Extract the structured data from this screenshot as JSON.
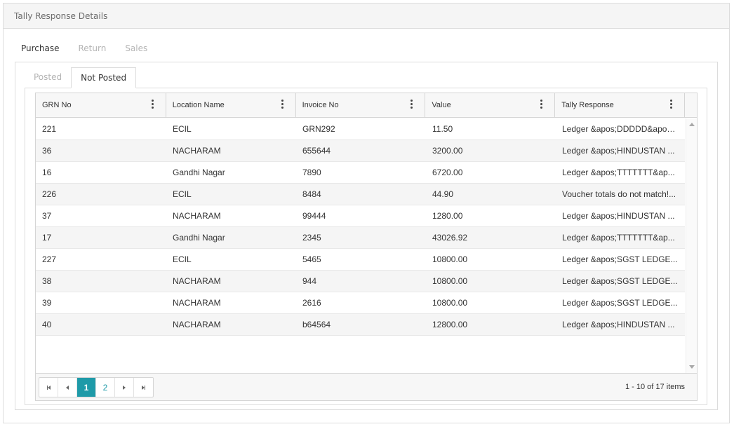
{
  "panel": {
    "title": "Tally Response Details"
  },
  "main_tabs": [
    {
      "label": "Purchase",
      "active": true
    },
    {
      "label": "Return",
      "active": false
    },
    {
      "label": "Sales",
      "active": false
    }
  ],
  "sub_tabs": [
    {
      "label": "Posted",
      "active": false
    },
    {
      "label": "Not Posted",
      "active": true
    }
  ],
  "grid": {
    "columns": [
      "GRN No",
      "Location Name",
      "Invoice No",
      "Value",
      "Tally Response"
    ],
    "rows": [
      [
        "221",
        "ECIL",
        "GRN292",
        "11.50",
        "Ledger &apos;DDDDD&apos;..."
      ],
      [
        "36",
        "NACHARAM",
        "655644",
        "3200.00",
        "Ledger &apos;HINDUSTAN ..."
      ],
      [
        "16",
        "Gandhi Nagar",
        "7890",
        "6720.00",
        "Ledger &apos;TTTTTTT&ap..."
      ],
      [
        "226",
        "ECIL",
        "8484",
        "44.90",
        "Voucher totals do not match!..."
      ],
      [
        "37",
        "NACHARAM",
        "99444",
        "1280.00",
        "Ledger &apos;HINDUSTAN ..."
      ],
      [
        "17",
        "Gandhi Nagar",
        "2345",
        "43026.92",
        "Ledger &apos;TTTTTTT&ap..."
      ],
      [
        "227",
        "ECIL",
        "5465",
        "10800.00",
        "Ledger &apos;SGST LEDGE..."
      ],
      [
        "38",
        "NACHARAM",
        "944",
        "10800.00",
        "Ledger &apos;SGST LEDGE..."
      ],
      [
        "39",
        "NACHARAM",
        "2616",
        "10800.00",
        "Ledger &apos;SGST LEDGE..."
      ],
      [
        "40",
        "NACHARAM",
        "b64564",
        "12800.00",
        "Ledger &apos;HINDUSTAN ..."
      ]
    ]
  },
  "pager": {
    "pages": [
      "1",
      "2"
    ],
    "current_page": "1",
    "info": "1 - 10 of 17 items"
  },
  "colors": {
    "accent": "#1e9aa8"
  }
}
